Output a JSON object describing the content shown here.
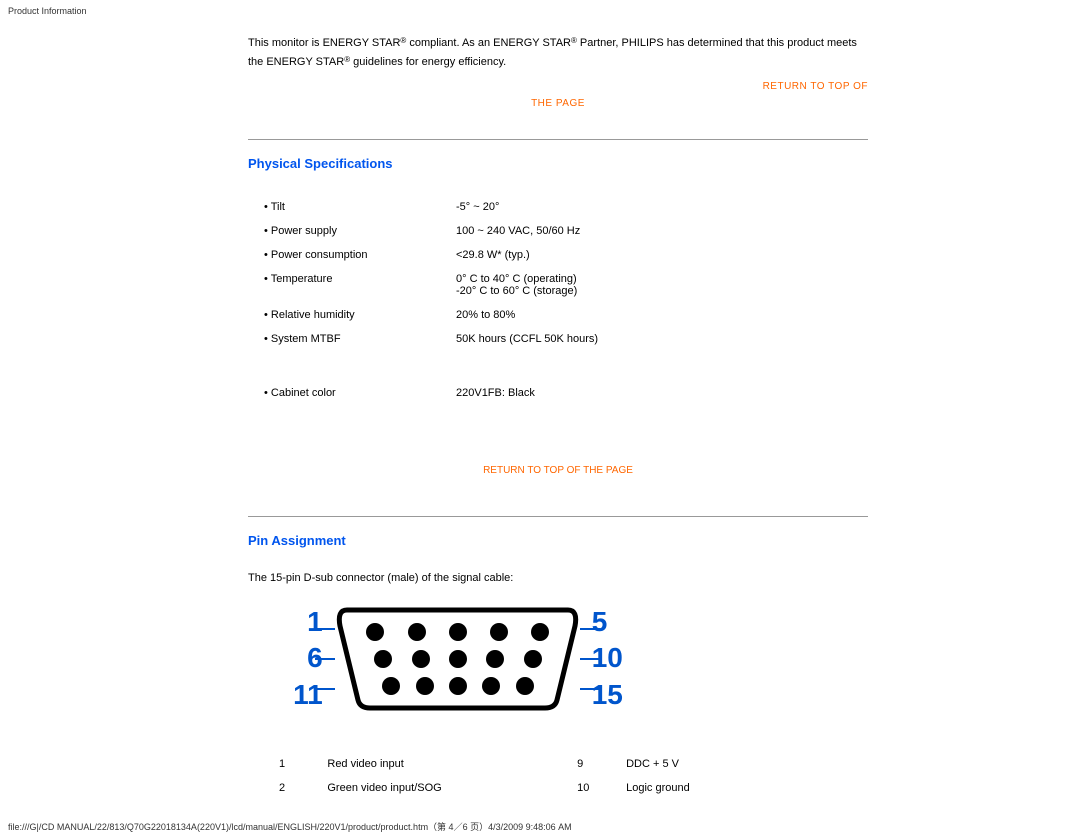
{
  "page_title": "Product Information",
  "energy_text_1": "This monitor is ENERGY STAR",
  "energy_text_2": " compliant. As an ENERGY STAR",
  "energy_text_3": " Partner, PHILIPS has determined that this product meets the ENERGY STAR",
  "energy_text_4": " guidelines for energy efficiency.",
  "return_link_1a": "RETURN TO TOP OF",
  "return_link_1b": "THE PAGE",
  "return_link_2": "RETURN TO TOP OF THE PAGE",
  "phys_spec_heading": "Physical Specifications",
  "specs": {
    "r0l": "• Tilt",
    "r0v": "-5° ~ 20°",
    "r1l": "• Power supply",
    "r1v": "100 ~ 240 VAC, 50/60 Hz",
    "r2l": "• Power consumption",
    "r2v": "<29.8 W* (typ.)",
    "r3l": "• Temperature",
    "r3v": "0° C to 40° C (operating)\n-20° C to 60° C (storage)",
    "r4l": "• Relative humidity",
    "r4v": "20% to 80%",
    "r5l": "• System MTBF",
    "r5v": "50K hours (CCFL 50K hours)",
    "r6l": "• Cabinet color",
    "r6v": "220V1FB: Black"
  },
  "pin_heading": "Pin Assignment",
  "pin_intro": "The 15-pin D-sub connector (male) of the signal cable:",
  "connector_numbers": {
    "l1": "1",
    "l2": "6",
    "l3": "11",
    "r1": "5",
    "r2": "10",
    "r3": "15"
  },
  "pin_table": {
    "r0a": "1",
    "r0b": "Red video input",
    "r0c": "9",
    "r0d": "DDC + 5 V",
    "r1a": "2",
    "r1b": "Green video input/SOG",
    "r1c": "10",
    "r1d": "Logic ground"
  },
  "footer": "file:///G|/CD MANUAL/22/813/Q70G22018134A(220V1)/lcd/manual/ENGLISH/220V1/product/product.htm（第 4／6 页）4/3/2009 9:48:06 AM"
}
